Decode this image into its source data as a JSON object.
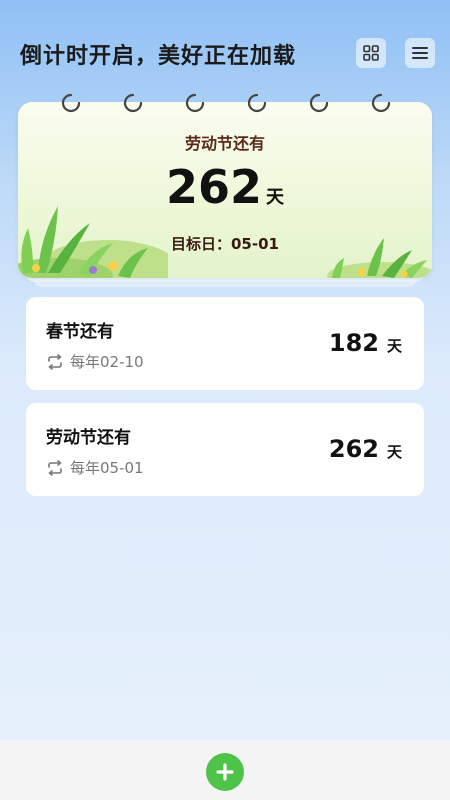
{
  "header": {
    "title": "倒计时开启，美好正在加载",
    "grid_icon": "grid-view-icon",
    "menu_icon": "menu-icon"
  },
  "featured": {
    "label": "劳动节还有",
    "days": "262",
    "unit": "天",
    "target": "目标日：05-01"
  },
  "events": [
    {
      "title": "春节还有",
      "repeat": "每年02-10",
      "days": "182",
      "unit": "天"
    },
    {
      "title": "劳动节还有",
      "repeat": "每年05-01",
      "days": "262",
      "unit": "天"
    }
  ],
  "bottom": {
    "add_icon": "plus-icon"
  },
  "colors": {
    "accent_green": "#4fc24a",
    "label_brown": "#5a2a16",
    "card_bg": "#ffffff"
  }
}
